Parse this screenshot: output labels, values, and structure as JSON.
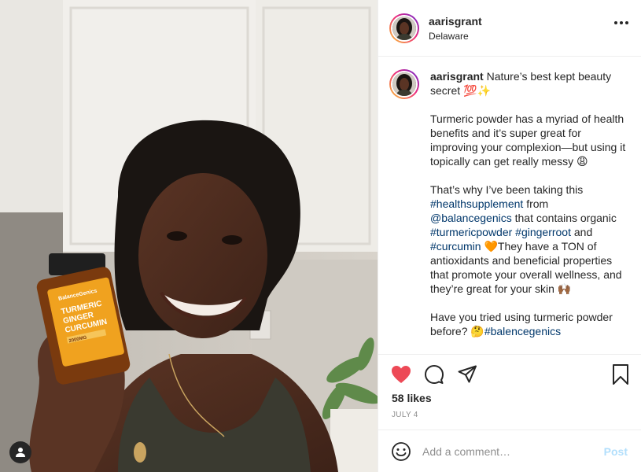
{
  "header": {
    "username": "aarisgrant",
    "location": "Delaware",
    "more_icon": "more-horizontal-icon"
  },
  "caption": {
    "username": "aarisgrant",
    "line1": "Nature’s best kept beauty secret 💯✨",
    "para2": "Turmeric powder has a myriad of health benefits and it’s super great for improving your complexion—but using it topically can get really messy 😩",
    "para3_a": "That’s why I’ve been taking this ",
    "hashtag_health": "#healthsupplement",
    "para3_b": " from ",
    "mention_balance": "@balancegenics",
    "para3_c": " that contains organic ",
    "hashtag_turmeric": "#turmericpowder",
    "hashtag_ginger": "#gingerroot",
    "para3_d": " and ",
    "hashtag_curcumin": "#curcumin",
    "para3_e": " 🧡They have a TON of antioxidants and beneficial properties that promote your overall wellness, and they’re great for your skin 🙌🏾",
    "para4": "Have you tried using turmeric powder before? 🤔",
    "hashtag_balancegenics": "#balencegenics"
  },
  "product": {
    "brand": "BalanceGenics",
    "line1": "TURMERIC",
    "line2": "GINGER",
    "line3": "CURCUMIN",
    "dose": "2000MG"
  },
  "actions": {
    "likes": "58 likes",
    "date": "JULY 4",
    "heart_color": "#ed4956"
  },
  "comment": {
    "placeholder": "Add a comment…",
    "post_label": "Post"
  }
}
